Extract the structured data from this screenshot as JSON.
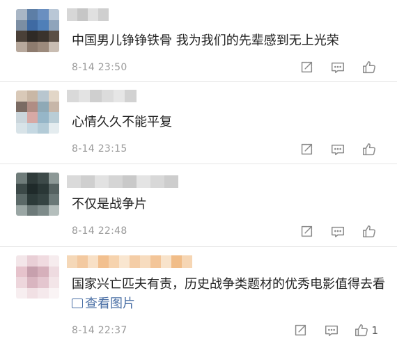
{
  "comments": [
    {
      "text": "中国男儿铮铮铁骨 我为我们的先辈感到无上光荣",
      "time": "8-14 23:50",
      "avatar_colors": [
        "#a9b6c5",
        "#5d7ea6",
        "#6a8fc0",
        "#b9c7d6",
        "#7c8ea3",
        "#3f6aa3",
        "#4f7fb8",
        "#8fa4bb",
        "#4a4038",
        "#2f2a26",
        "#3a332d",
        "#5a4e44",
        "#b7a89c",
        "#8d7b6e",
        "#9c8a7c",
        "#c9bdb2"
      ],
      "username_colors": [
        "#d7d7d7",
        "#c6c6c6",
        "#e0e0e0",
        "#cfcfcf"
      ],
      "has_like_count": false,
      "like_count": ""
    },
    {
      "text": "心情久久不能平复",
      "time": "8-14 23:15",
      "avatar_colors": [
        "#d9c9b8",
        "#c9b7a5",
        "#b8c6cf",
        "#e2d6c7",
        "#7b6b63",
        "#b08d84",
        "#8fa9b6",
        "#c7b6a8",
        "#cbd6dc",
        "#d7a9a5",
        "#96b6c8",
        "#b9cdd6",
        "#d8e3e8",
        "#c5d8e2",
        "#b3cbd7",
        "#e4ecef"
      ],
      "username_colors": [
        "#d9d9d9",
        "#e3e3e3",
        "#cfcfcf",
        "#dcdcdc",
        "#e6e6e6",
        "#d2d2d2"
      ],
      "has_like_count": false,
      "like_count": ""
    },
    {
      "text": "不仅是战争片",
      "time": "8-14 22:48",
      "avatar_colors": [
        "#6f7c7a",
        "#2f3b3a",
        "#3d4a49",
        "#8c9896",
        "#3c4948",
        "#1f2a2a",
        "#2a3736",
        "#556261",
        "#5b6968",
        "#2c3a39",
        "#354342",
        "#6a7877",
        "#9aa6a4",
        "#6d7a79",
        "#7e8b8a",
        "#b4bebc"
      ],
      "username_colors": [
        "#dadada",
        "#cfcfcf",
        "#e2e2e2",
        "#d5d5d5",
        "#c9c9c9",
        "#e4e4e4",
        "#d8d8d8",
        "#cdcdcd"
      ],
      "has_like_count": false,
      "like_count": ""
    },
    {
      "text": "国家兴亡匹夫有责，历史战争类题材的优秀电影值得去看",
      "view_image_label": "查看图片",
      "time": "8-14 22:37",
      "avatar_colors": [
        "#f3e6e9",
        "#e9cfd6",
        "#f0dbe0",
        "#f6ecee",
        "#e6c3cc",
        "#c7a0ad",
        "#d6b0bb",
        "#eedbe0",
        "#edd6dc",
        "#d9b5c0",
        "#e4c6cf",
        "#f3e5e8",
        "#f7eef0",
        "#f1e0e4",
        "#f5e9ec",
        "#faf4f5"
      ],
      "username_colors": [
        "#f5d8b8",
        "#f3c9a0",
        "#f8e0c6",
        "#f2c08f",
        "#f6d3ae",
        "#f9e6d0",
        "#f4cda6",
        "#f7dcbf",
        "#f3c598",
        "#f8e3cb",
        "#f1bd88",
        "#f6d6b4"
      ],
      "has_like_count": true,
      "like_count": "1"
    }
  ],
  "icons": {
    "share": "share-icon",
    "reply": "comment-icon",
    "like": "thumbs-up-icon",
    "view_image": "image-icon"
  },
  "colors": {
    "text": "#222222",
    "time": "#9a9a9a",
    "icon": "#8a8a8a",
    "link": "#4a6fa5",
    "divider": "#e6e6e6"
  }
}
